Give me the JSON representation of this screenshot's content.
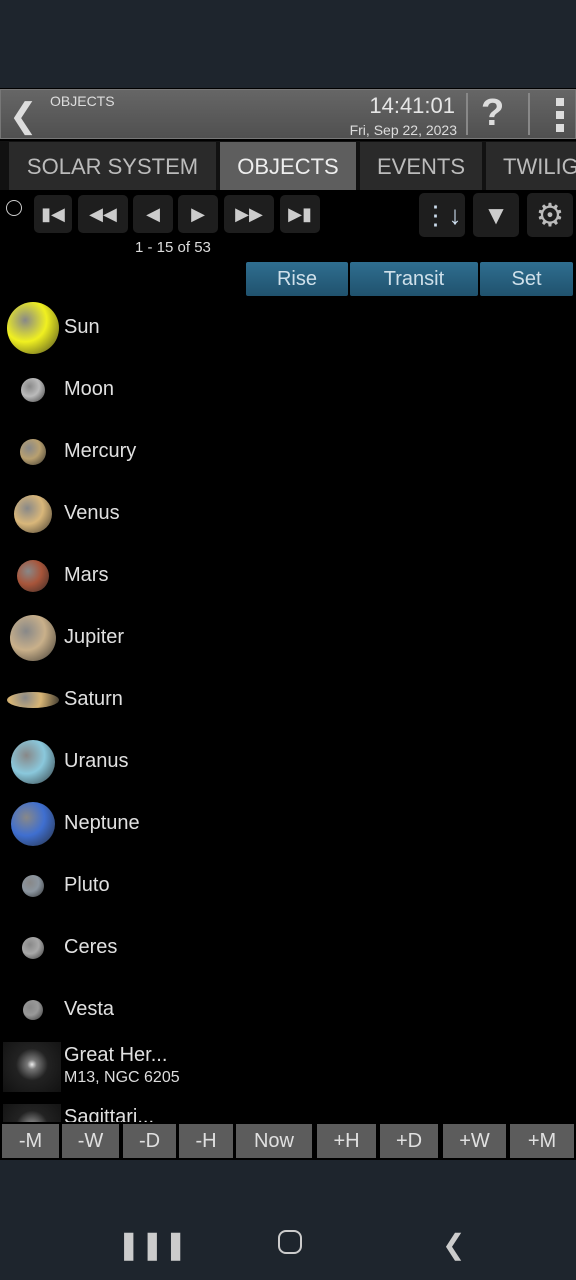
{
  "header": {
    "title": "OBJECTS",
    "time": "14:41:01",
    "date": "Fri, Sep 22, 2023"
  },
  "tabs": [
    {
      "label": "SOLAR SYSTEM"
    },
    {
      "label": "OBJECTS",
      "active": true
    },
    {
      "label": "EVENTS"
    },
    {
      "label": "TWILIG"
    }
  ],
  "pager": {
    "count": "1 - 15 of 53"
  },
  "columns": {
    "rise": "Rise",
    "transit": "Transit",
    "set": "Set"
  },
  "objects": [
    {
      "name": "Sun",
      "color": "#f0f020"
    },
    {
      "name": "Moon",
      "color": "#bbbbbb"
    },
    {
      "name": "Mercury",
      "color": "#b8a070"
    },
    {
      "name": "Venus",
      "color": "#d9b77a"
    },
    {
      "name": "Mars",
      "color": "#a8553a"
    },
    {
      "name": "Jupiter",
      "color": "#c9b08a"
    },
    {
      "name": "Saturn",
      "color": "#d8b575"
    },
    {
      "name": "Uranus",
      "color": "#8ac8dc"
    },
    {
      "name": "Neptune",
      "color": "#3f6fd0"
    },
    {
      "name": "Pluto",
      "color": "#8c96a0"
    },
    {
      "name": "Ceres",
      "color": "#a8a8a8"
    },
    {
      "name": "Vesta",
      "color": "#999999"
    },
    {
      "name": "Great Her...",
      "subtitle": "M13, NGC 6205",
      "color": "#444444"
    },
    {
      "name": "Sagittari...",
      "color": "#333333"
    }
  ],
  "time_buttons": [
    "-M",
    "-W",
    "-D",
    "-H",
    "Now",
    "+H",
    "+D",
    "+W",
    "+M"
  ],
  "colors": {
    "accent": "#2a6385",
    "header": "#5a5a5a",
    "system_bar": "#1e252d"
  }
}
